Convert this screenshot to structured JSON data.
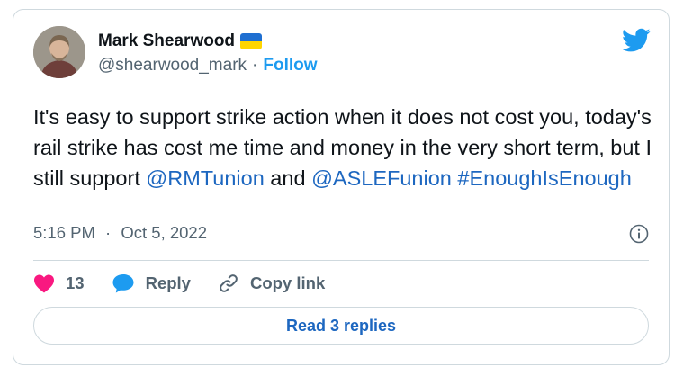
{
  "author": {
    "name": "Mark Shearwood",
    "handle": "@shearwood_mark",
    "separator": "·",
    "follow_label": "Follow",
    "flag_icon": "ukraine-flag-icon"
  },
  "tweet": {
    "text_segments": [
      "It's easy to support strike action when it does not cost you, today's rail strike has cost me time and money in the very short term, but I still support ",
      "@RMTunion",
      " and ",
      "@ASLEFunion",
      " ",
      "#EnoughIsEnough"
    ],
    "time": "5:16 PM",
    "date_separator": "·",
    "date": "Oct 5, 2022"
  },
  "actions": {
    "like_count": "13",
    "reply_label": "Reply",
    "copy_link_label": "Copy link"
  },
  "read_replies_label": "Read 3 replies",
  "colors": {
    "link": "#1d67c0",
    "twitter_blue": "#1d9bf0",
    "heart": "#f91880",
    "text": "#0f1419",
    "muted": "#536471"
  }
}
